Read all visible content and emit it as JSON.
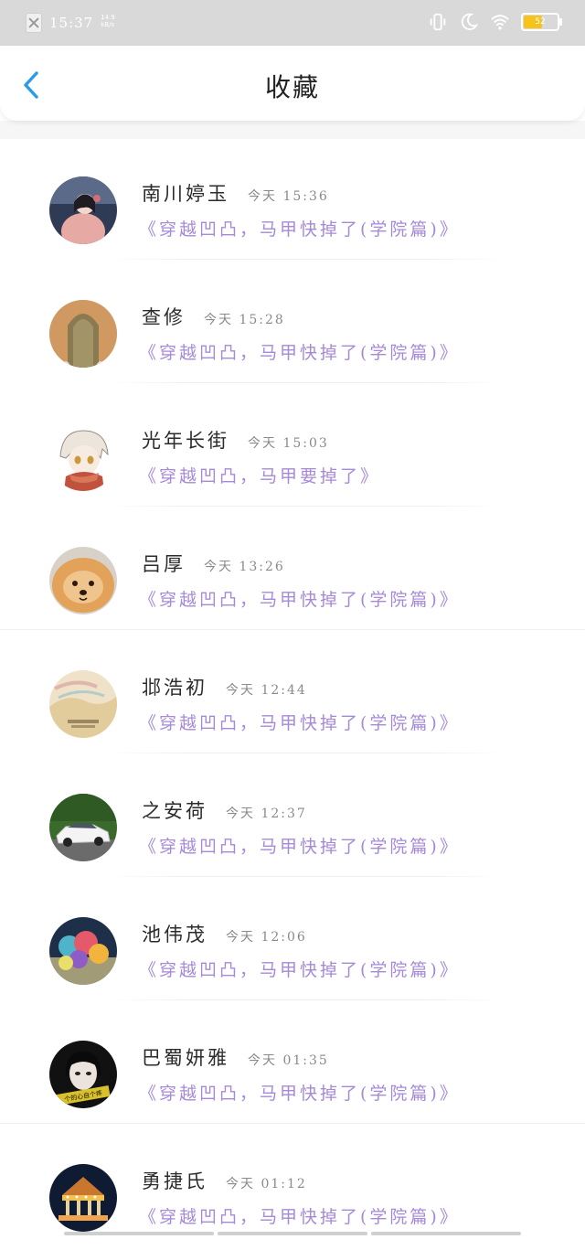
{
  "status_bar": {
    "time": "15:37",
    "net_speed_top": "14.9",
    "net_speed_bottom": "kB/s",
    "battery_level": "52",
    "icons": [
      "notification-close-icon",
      "vibrate-icon",
      "do-not-disturb-moon-icon",
      "wifi-icon",
      "battery-icon"
    ],
    "colors": {
      "background": "#d9d9d9",
      "battery_fill": "#f7c21a"
    }
  },
  "header": {
    "title": "收藏",
    "back_icon": "chevron-left-icon",
    "colors": {
      "back": "#2d9be8",
      "title": "#222222"
    }
  },
  "colors": {
    "message": "#a68ad8",
    "name": "#2b2b2b",
    "time": "#8a8a8a"
  },
  "items": [
    {
      "name": "南川婷玉",
      "time": "今天 15:36",
      "message": "《穿越凹凸，马甲快掉了(学院篇)》",
      "avatar": "girl-portrait-avatar"
    },
    {
      "name": "查修",
      "time": "今天 15:28",
      "message": "《穿越凹凸，马甲快掉了(学院篇)》",
      "avatar": "long-hair-back-avatar"
    },
    {
      "name": "光年长街",
      "time": "今天 15:03",
      "message": "《穿越凹凸，马甲要掉了》",
      "avatar": "anime-boy-avatar"
    },
    {
      "name": "吕厚",
      "time": "今天 13:26",
      "message": "《穿越凹凸，马甲快掉了(学院篇)》",
      "avatar": "pomeranian-dog-avatar"
    },
    {
      "name": "邶浩初",
      "time": "今天 12:44",
      "message": "《穿越凹凸，马甲快掉了(学院篇)》",
      "avatar": "watercolor-art-avatar"
    },
    {
      "name": "之安荷",
      "time": "今天 12:37",
      "message": "《穿越凹凸，马甲快掉了(学院篇)》",
      "avatar": "white-car-avatar"
    },
    {
      "name": "池伟茂",
      "time": "今天 12:06",
      "message": "《穿越凹凸，马甲快掉了(学院篇)》",
      "avatar": "colorful-balloons-avatar"
    },
    {
      "name": "巴蜀妍雅",
      "time": "今天 01:35",
      "message": "《穿越凹凸，马甲快掉了(学院篇)》",
      "avatar": "girl-with-caption-avatar",
      "avatar_caption": "个的心自个疼"
    },
    {
      "name": "勇捷氏",
      "time": "今天 01:12",
      "message": "《穿越凹凸，马甲快掉了(学院篇)》",
      "avatar": "carousel-night-avatar"
    }
  ]
}
